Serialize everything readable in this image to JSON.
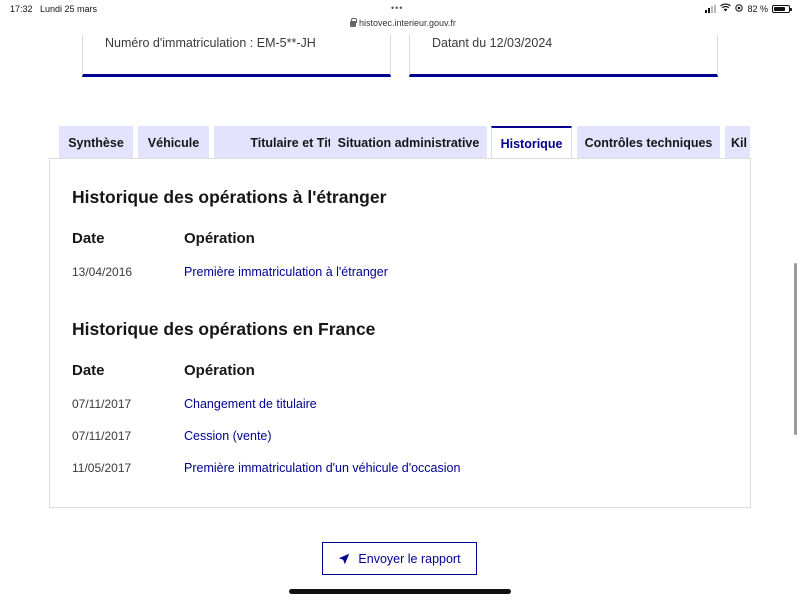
{
  "status_bar": {
    "time": "17:32",
    "date": "Lundi 25 mars",
    "dots": "•••",
    "url": "histovec.interieur.gouv.fr",
    "battery": "82 %"
  },
  "cards": {
    "registration_label": "Numéro d'immatriculation : EM-5**-JH",
    "date_label": "Datant du 12/03/2024"
  },
  "tabs": [
    {
      "label": "Synthèse"
    },
    {
      "label": "Véhicule"
    },
    {
      "label": "Titulaire et Titre"
    },
    {
      "label": "Situation administrative"
    },
    {
      "label": "Historique",
      "active": true
    },
    {
      "label": "Contrôles techniques"
    },
    {
      "label": "Kil"
    }
  ],
  "foreign_history": {
    "title": "Historique des opérations à l'étranger",
    "col_date": "Date",
    "col_operation": "Opération",
    "rows": [
      {
        "date": "13/04/2016",
        "operation": "Première immatriculation à l'étranger"
      }
    ]
  },
  "france_history": {
    "title": "Historique des opérations en France",
    "col_date": "Date",
    "col_operation": "Opération",
    "rows": [
      {
        "date": "07/11/2017",
        "operation": "Changement de titulaire"
      },
      {
        "date": "07/11/2017",
        "operation": "Cession (vente)"
      },
      {
        "date": "11/05/2017",
        "operation": "Première immatriculation d'un véhicule d'occasion"
      }
    ]
  },
  "send_button": {
    "label": "Envoyer le rapport",
    "icon": "send-icon"
  },
  "colors": {
    "accent": "#000091",
    "tab_bg": "#e3e3fd",
    "border": "#dddddd"
  }
}
